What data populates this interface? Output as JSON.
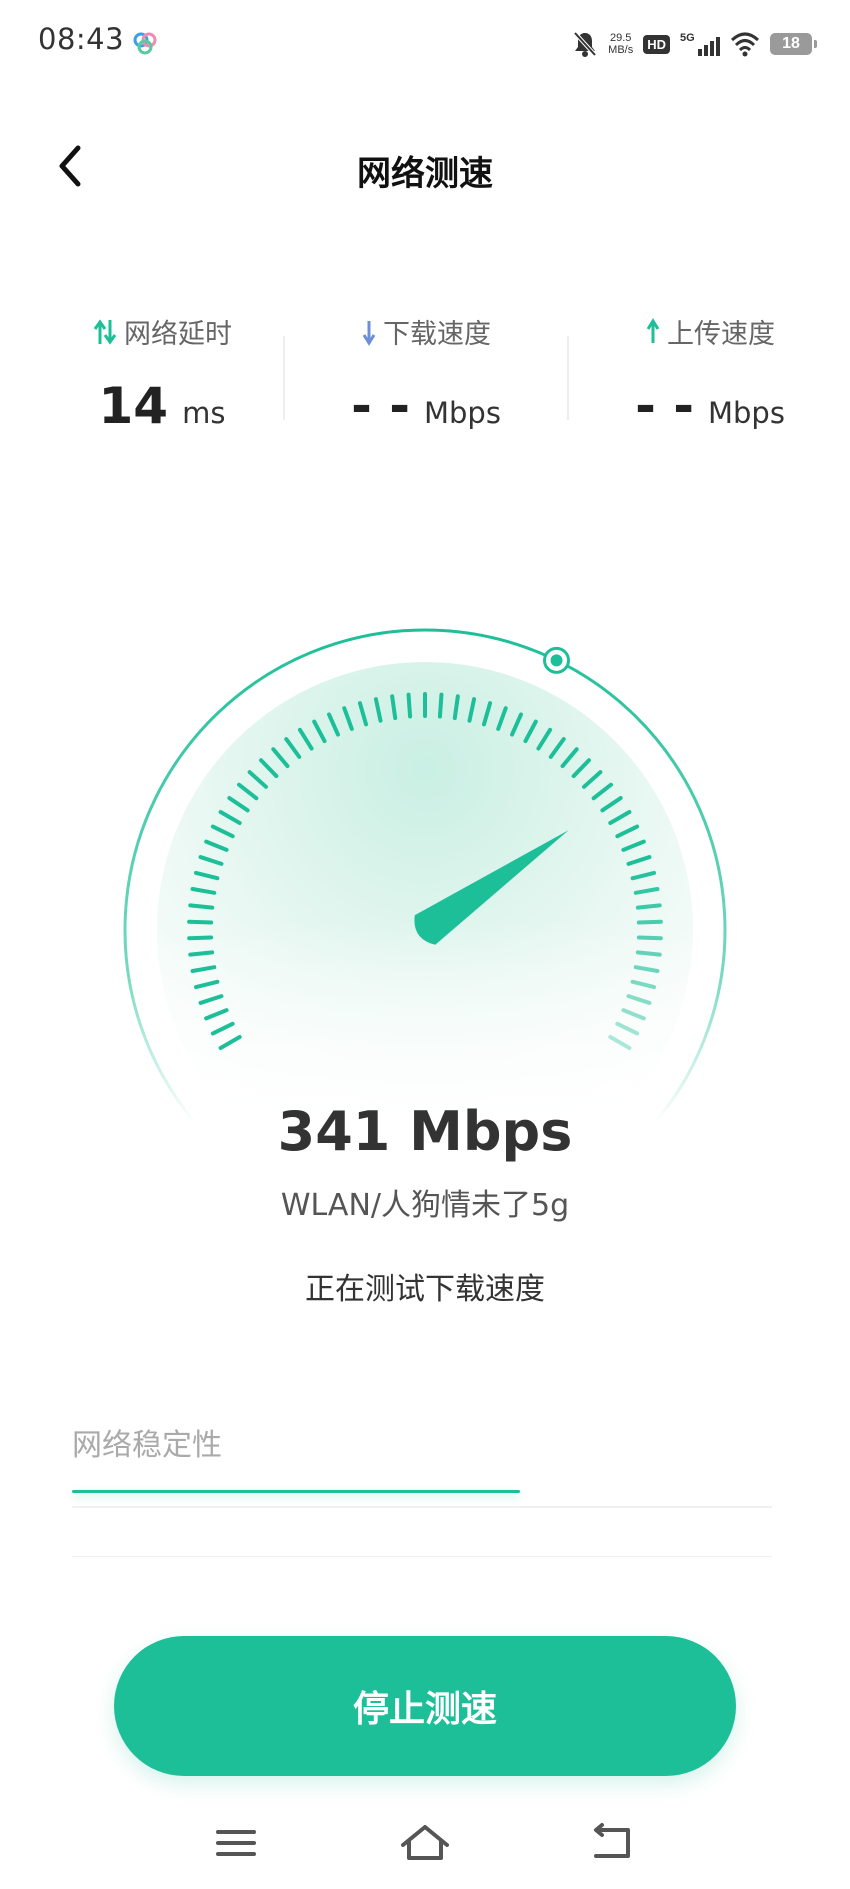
{
  "status_bar": {
    "time": "08:43",
    "net_speed_value": "29.5",
    "net_speed_unit": "MB/s",
    "hd_label": "HD",
    "signal_label": "5G",
    "battery": "18"
  },
  "header": {
    "title": "网络测速"
  },
  "metrics": [
    {
      "label": "网络延时",
      "value": "14",
      "unit": "ms",
      "icon": "up-down-arrows-icon"
    },
    {
      "label": "下载速度",
      "value": "- -",
      "unit": "Mbps",
      "icon": "down-arrow-icon"
    },
    {
      "label": "上传速度",
      "value": "- -",
      "unit": "Mbps",
      "icon": "up-arrow-icon"
    }
  ],
  "gauge": {
    "current_speed": "341 Mbps",
    "needle_fraction": 0.73,
    "progress_fraction": 0.6
  },
  "network_name": "WLAN/人狗情未了5g",
  "test_status": "正在测试下载速度",
  "stability": {
    "label": "网络稳定性",
    "progress": 0.64
  },
  "actions": {
    "stop_button": "停止测速"
  },
  "colors": {
    "accent": "#1cbf98",
    "download_icon": "#6c8fd8"
  },
  "nav_bar": {
    "menu_icon": "menu-icon",
    "home_icon": "home-icon",
    "back_icon": "back-return-icon"
  }
}
